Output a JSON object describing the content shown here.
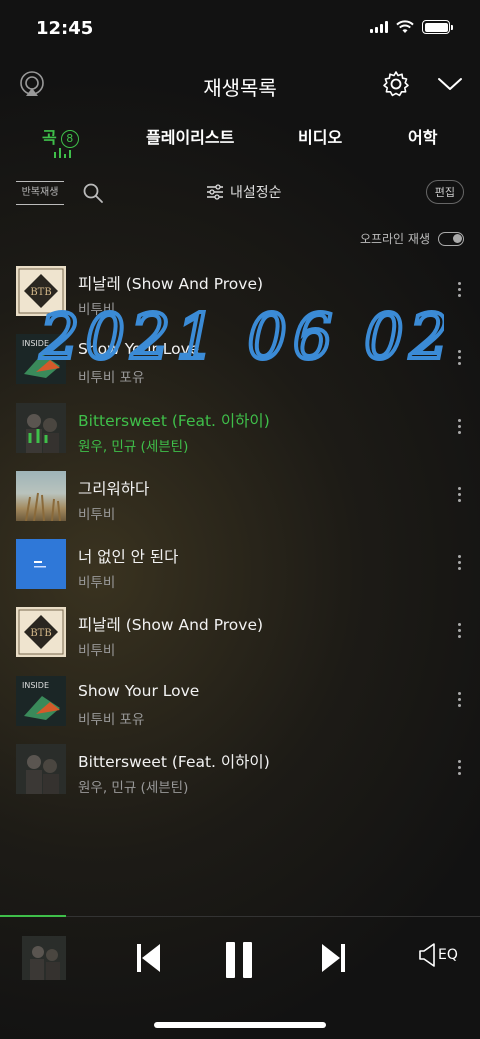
{
  "status": {
    "time": "12:45"
  },
  "header": {
    "title": "재생목록"
  },
  "tabs": [
    {
      "label": "곡",
      "count": "8"
    },
    {
      "label": "플레이리스트"
    },
    {
      "label": "비디오"
    },
    {
      "label": "어학"
    }
  ],
  "toolbar": {
    "repeat_label": "반복재생",
    "sort_label": "내설정순",
    "edit_label": "편집"
  },
  "offline": {
    "label": "오프라인 재생"
  },
  "songs": [
    {
      "title": "피날레 (Show And Prove)",
      "artist": "비투비"
    },
    {
      "title": "Show Your Love",
      "artist": "비투비 포유"
    },
    {
      "title": "Bittersweet (Feat. 이하이)",
      "artist": "원우, 민규 (세븐틴)"
    },
    {
      "title": "그리워하다",
      "artist": "비투비"
    },
    {
      "title": "너 없인 안 된다",
      "artist": "비투비"
    },
    {
      "title": "피날레 (Show And Prove)",
      "artist": "비투비"
    },
    {
      "title": "Show Your Love",
      "artist": "비투비 포유"
    },
    {
      "title": "Bittersweet (Feat. 이하이)",
      "artist": "원우, 민규 (세븐틴)"
    }
  ],
  "player": {
    "eq_label": "EQ"
  },
  "overlay": {
    "handwriting": "2021 06 02"
  },
  "colors": {
    "accent": "#3fbf4a",
    "handwriting": "#3b8bd6"
  }
}
